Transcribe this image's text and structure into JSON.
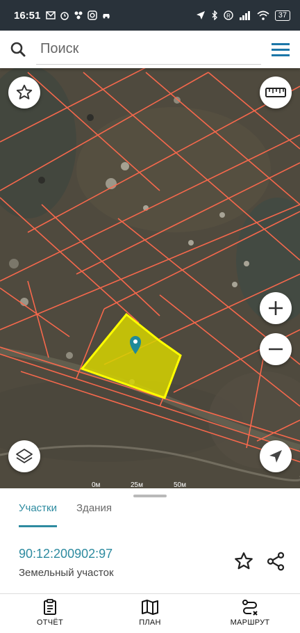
{
  "statusbar": {
    "time": "16:51",
    "battery": "37"
  },
  "search": {
    "placeholder": "Поиск"
  },
  "map": {
    "scale_labels": [
      "0м",
      "25м",
      "50м"
    ],
    "parcel_highlight_color": "#ffff00",
    "boundary_color": "#ff6a4d"
  },
  "sheet": {
    "tabs": [
      {
        "label": "Участки",
        "active": true
      },
      {
        "label": "Здания",
        "active": false
      }
    ],
    "parcel": {
      "cadastral_number": "90:12:200902:97",
      "type": "Земельный участок"
    }
  },
  "bottom_nav": [
    {
      "label": "ОТЧЁТ",
      "icon": "report-icon"
    },
    {
      "label": "ПЛАН",
      "icon": "map-plan-icon"
    },
    {
      "label": "МАРШРУТ",
      "icon": "route-icon"
    }
  ],
  "colors": {
    "accent": "#2e8ba0",
    "statusbar": "#29323a"
  }
}
